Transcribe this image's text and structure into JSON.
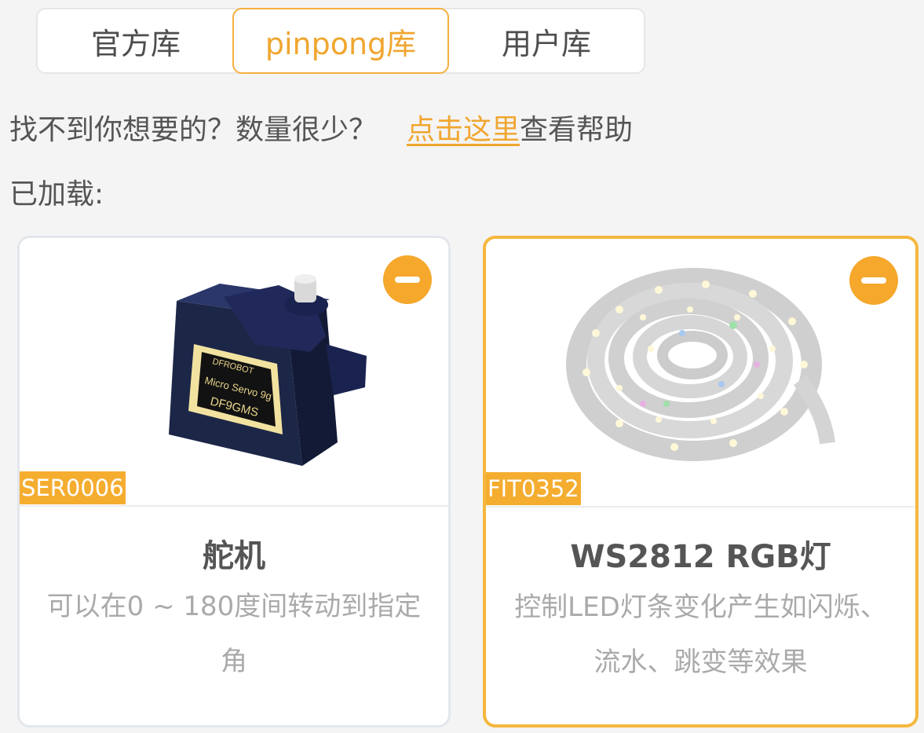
{
  "tabs": [
    {
      "label": "官方库"
    },
    {
      "label": "pinpong库"
    },
    {
      "label": "用户库"
    }
  ],
  "help": {
    "prefix": "找不到你想要的？数量很少？",
    "link": "点击这里",
    "suffix": "查看帮助"
  },
  "loaded_label": "已加载:",
  "cards": [
    {
      "tag": "SER0006",
      "title": "舵机",
      "desc": "可以在0 ~ 180度间转动到指定角",
      "image": "micro-servo-image",
      "image_text": [
        "DFROBOT",
        "Micro Servo 9g",
        "DF9GMS"
      ]
    },
    {
      "tag": "FIT0352",
      "title": "WS2812 RGB灯",
      "desc": "控制LED灯条变化产生如闪烁、流水、跳变等效果",
      "image": "led-strip-image"
    }
  ],
  "colors": {
    "accent": "#f5ad30",
    "text": "#555555",
    "muted": "#aaaaaa"
  }
}
